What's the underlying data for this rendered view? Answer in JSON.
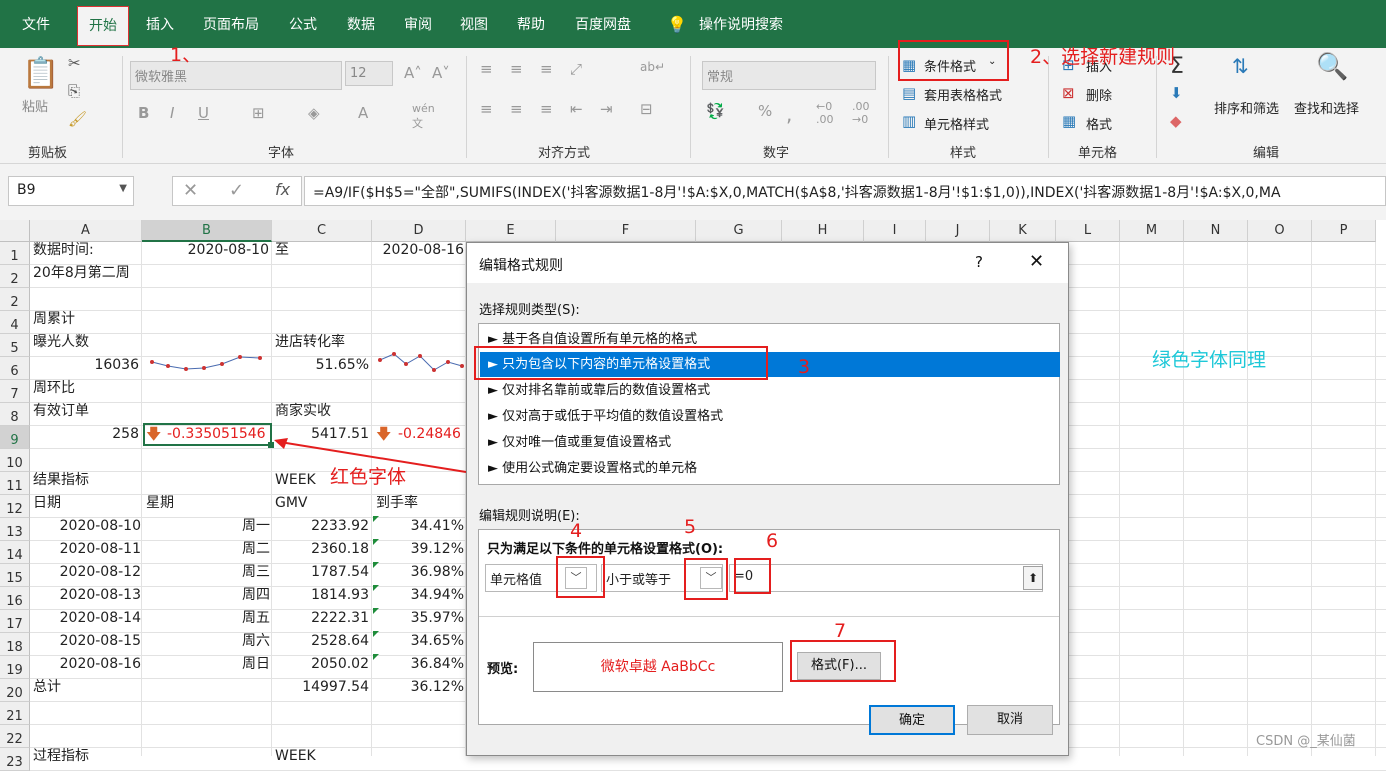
{
  "menu": {
    "items": [
      "文件",
      "开始",
      "插入",
      "页面布局",
      "公式",
      "数据",
      "审阅",
      "视图",
      "帮助",
      "百度网盘"
    ],
    "search_label": "操作说明搜索"
  },
  "ribbon": {
    "paste": "粘贴",
    "font_name": "微软雅黑",
    "font_size": "12",
    "number_format": "常规",
    "cond_format": "条件格式",
    "table_format": "套用表格格式",
    "cell_style": "单元格样式",
    "insert": "插入",
    "delete": "删除",
    "format": "格式",
    "sort_filter": "排序和筛选",
    "find_select": "查找和选择",
    "groups": [
      "剪贴板",
      "字体",
      "对齐方式",
      "数字",
      "样式",
      "单元格",
      "编辑"
    ]
  },
  "formula_bar": {
    "name_box": "B9",
    "formula": "=A9/IF($H$5=\"全部\",SUMIFS(INDEX('抖客源数据1-8月'!$A:$X,0,MATCH($A$8,'抖客源数据1-8月'!$1:$1,0)),INDEX('抖客源数据1-8月'!$A:$X,0,MA"
  },
  "grid": {
    "columns": [
      "A",
      "B",
      "C",
      "D",
      "E",
      "F",
      "G",
      "H",
      "I",
      "J",
      "K",
      "L",
      "M",
      "N",
      "O",
      "P"
    ],
    "rows": [
      "1",
      "2",
      "2",
      "4",
      "5",
      "6",
      "7",
      "8",
      "9",
      "10",
      "11",
      "12",
      "13",
      "14",
      "15",
      "16",
      "17",
      "18",
      "19",
      "20",
      "21",
      "22",
      "23"
    ],
    "cells": {
      "a1": "数据时间:",
      "b1": "2020-08-10",
      "c1": "至",
      "d1": "2020-08-16",
      "a2": "20年8月第二周",
      "a4": "周累计",
      "a5": "曝光人数",
      "c5": "进店转化率",
      "a6": "16036",
      "c6": "51.65%",
      "a7": "周环比",
      "a8": "有效订单",
      "c8": "商家实收",
      "a9": "258",
      "b9": "-0.335051546",
      "c9": "5417.51",
      "d9": "-0.24846",
      "a11": "结果指标",
      "c11": "WEEK",
      "a12": "日期",
      "b12": "星期",
      "c12": "GMV",
      "d12": "到手率",
      "a20": "总计",
      "c20": "14997.54",
      "d20": "36.12%",
      "a23": "过程指标",
      "c23": "WEEK"
    },
    "daily": [
      {
        "date": "2020-08-10",
        "day": "周一",
        "gmv": "2233.92",
        "rate": "34.41%"
      },
      {
        "date": "2020-08-11",
        "day": "周二",
        "gmv": "2360.18",
        "rate": "39.12%"
      },
      {
        "date": "2020-08-12",
        "day": "周三",
        "gmv": "1787.54",
        "rate": "36.98%"
      },
      {
        "date": "2020-08-13",
        "day": "周四",
        "gmv": "1814.93",
        "rate": "34.94%"
      },
      {
        "date": "2020-08-14",
        "day": "周五",
        "gmv": "2222.31",
        "rate": "35.97%"
      },
      {
        "date": "2020-08-15",
        "day": "周六",
        "gmv": "2528.64",
        "rate": "34.65%"
      },
      {
        "date": "2020-08-16",
        "day": "周日",
        "gmv": "2050.02",
        "rate": "36.84%"
      }
    ]
  },
  "dialog": {
    "title": "编辑格式规则",
    "help": "?",
    "select_type": "选择规则类型(S):",
    "rules": [
      "► 基于各自值设置所有单元格的格式",
      "► 只为包含以下内容的单元格设置格式",
      "► 仅对排名靠前或靠后的数值设置格式",
      "► 仅对高于或低于平均值的数值设置格式",
      "► 仅对唯一值或重复值设置格式",
      "► 使用公式确定要设置格式的单元格"
    ],
    "edit_desc": "编辑规则说明(E):",
    "condition_title": "只为满足以下条件的单元格设置格式(O):",
    "cond_field": "单元格值",
    "cond_op": "小于或等于",
    "cond_value": "=0",
    "preview_label": "预览:",
    "preview_text": "微软卓越  AaBbCc",
    "format_button": "格式(F)...",
    "ok": "确定",
    "cancel": "取消"
  },
  "annotations": {
    "n1": "1、",
    "n2": "2、选择新建规则",
    "n3": "3",
    "n4": "4",
    "n5": "5",
    "n6": "6",
    "n7": "7",
    "red_font": "红色字体",
    "green_font": "绿色字体同理"
  },
  "watermark": "CSDN @_某仙菌",
  "colors": {
    "excel_green": "#217346",
    "annotation_red": "#e41e1e",
    "annotation_cyan": "#1ec8d8",
    "selection_blue": "#0078d7"
  }
}
